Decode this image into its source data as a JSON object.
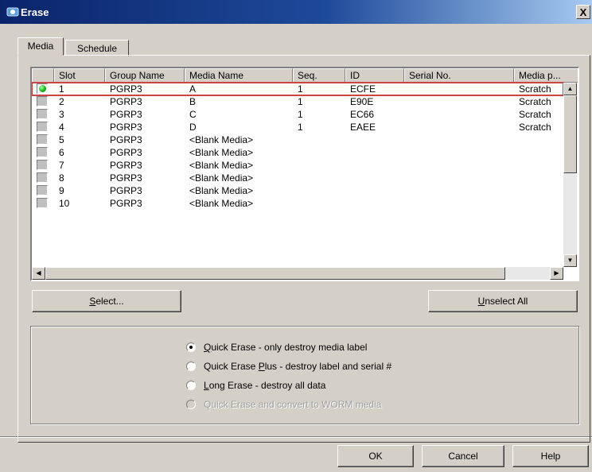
{
  "window": {
    "title": "Erase",
    "close_glyph": "X",
    "icon": "app-icon"
  },
  "tabs": [
    {
      "label": "Media",
      "active": true
    },
    {
      "label": "Schedule",
      "active": false
    }
  ],
  "table": {
    "columns": [
      "",
      "Slot",
      "Group Name",
      "Media Name",
      "Seq.",
      "ID",
      "Serial No.",
      "Media p..."
    ],
    "rows": [
      {
        "checked": true,
        "slot": "1",
        "group": "PGRP3",
        "media": "A",
        "seq": "1",
        "id": "ECFE",
        "serial": "",
        "pool": "Scratch"
      },
      {
        "checked": false,
        "slot": "2",
        "group": "PGRP3",
        "media": "B",
        "seq": "1",
        "id": "E90E",
        "serial": "",
        "pool": "Scratch"
      },
      {
        "checked": false,
        "slot": "3",
        "group": "PGRP3",
        "media": "C",
        "seq": "1",
        "id": "EC66",
        "serial": "",
        "pool": "Scratch"
      },
      {
        "checked": false,
        "slot": "4",
        "group": "PGRP3",
        "media": "D",
        "seq": "1",
        "id": "EAEE",
        "serial": "",
        "pool": "Scratch"
      },
      {
        "checked": false,
        "slot": "5",
        "group": "PGRP3",
        "media": "<Blank Media>",
        "seq": "",
        "id": "",
        "serial": "",
        "pool": ""
      },
      {
        "checked": false,
        "slot": "6",
        "group": "PGRP3",
        "media": "<Blank Media>",
        "seq": "",
        "id": "",
        "serial": "",
        "pool": ""
      },
      {
        "checked": false,
        "slot": "7",
        "group": "PGRP3",
        "media": "<Blank Media>",
        "seq": "",
        "id": "",
        "serial": "",
        "pool": ""
      },
      {
        "checked": false,
        "slot": "8",
        "group": "PGRP3",
        "media": "<Blank Media>",
        "seq": "",
        "id": "",
        "serial": "",
        "pool": ""
      },
      {
        "checked": false,
        "slot": "9",
        "group": "PGRP3",
        "media": "<Blank Media>",
        "seq": "",
        "id": "",
        "serial": "",
        "pool": ""
      },
      {
        "checked": false,
        "slot": "10",
        "group": "PGRP3",
        "media": "<Blank Media>",
        "seq": "",
        "id": "",
        "serial": "",
        "pool": ""
      }
    ],
    "selected_row": 0
  },
  "buttons": {
    "select": {
      "mnemonic": "S",
      "rest": "elect..."
    },
    "unselect_all": {
      "mnemonic": "U",
      "rest": "nselect All"
    },
    "ok": "OK",
    "cancel": "Cancel",
    "help": "Help"
  },
  "erase_options": [
    {
      "pre": "",
      "mnemonic": "Q",
      "post": "uick Erase - only destroy media label",
      "selected": true,
      "enabled": true
    },
    {
      "pre": "Quick Erase ",
      "mnemonic": "P",
      "post": "lus - destroy label and serial #",
      "selected": false,
      "enabled": true
    },
    {
      "pre": "",
      "mnemonic": "L",
      "post": "ong Erase - destroy all data",
      "selected": false,
      "enabled": true
    },
    {
      "pre": "Quick Erase and convert to WORM media",
      "mnemonic": "",
      "post": "",
      "selected": false,
      "enabled": false
    }
  ],
  "colors": {
    "title_start": "#0a246a",
    "title_end": "#a6caf0",
    "selection_outline": "#cc4444",
    "checked_led": "#11bb11"
  }
}
